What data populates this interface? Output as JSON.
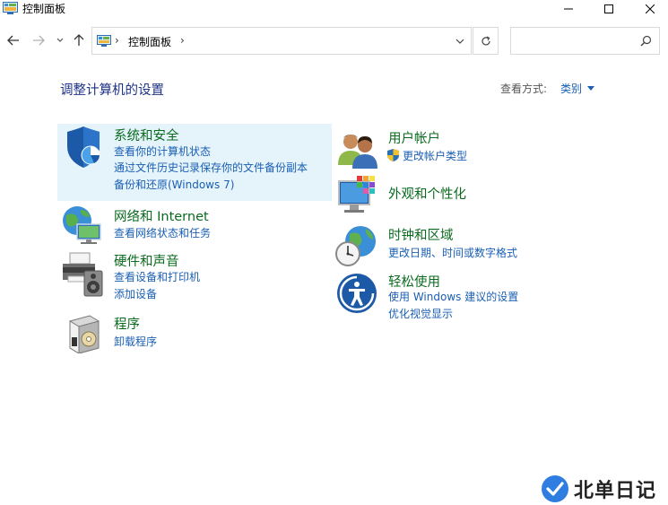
{
  "window": {
    "title": "控制面板",
    "icon": "control-panel-icon",
    "controls": [
      "minimize-icon",
      "maximize-icon",
      "close-icon"
    ]
  },
  "addressbar": {
    "breadcrumb": "控制面板",
    "separator": "›",
    "search_placeholder": ""
  },
  "header": {
    "title": "调整计算机的设置",
    "view_by_label": "查看方式:",
    "view_by_value": "类别"
  },
  "categories_left": [
    {
      "title": "系统和安全",
      "icon": "shield-icon",
      "links": [
        "查看你的计算机状态",
        "通过文件历史记录保存你的文件备份副本",
        "备份和还原(Windows 7)"
      ],
      "highlighted": true
    },
    {
      "title": "网络和 Internet",
      "icon": "network-globe-icon",
      "links": [
        "查看网络状态和任务"
      ]
    },
    {
      "title": "硬件和声音",
      "icon": "printer-speaker-icon",
      "links": [
        "查看设备和打印机",
        "添加设备"
      ]
    },
    {
      "title": "程序",
      "icon": "program-box-icon",
      "links": [
        "卸载程序"
      ]
    }
  ],
  "categories_right": [
    {
      "title": "用户帐户",
      "icon": "users-icon",
      "links": [
        "更改帐户类型"
      ],
      "link_icons": [
        "uac-shield-icon"
      ]
    },
    {
      "title": "外观和个性化",
      "icon": "monitor-palette-icon",
      "links": []
    },
    {
      "title": "时钟和区域",
      "icon": "clock-globe-icon",
      "links": [
        "更改日期、时间或数字格式"
      ]
    },
    {
      "title": "轻松使用",
      "icon": "ease-of-access-icon",
      "links": [
        "使用 Windows 建议的设置",
        "优化视觉显示"
      ]
    }
  ],
  "watermark": {
    "text": "北单日记",
    "icon": "checkmark-logo-icon"
  },
  "colors": {
    "title_green": "#0a6b1e",
    "link_blue": "#1a5fb4",
    "heading_blue": "#1e3287",
    "highlight": "#e5f3fb"
  }
}
